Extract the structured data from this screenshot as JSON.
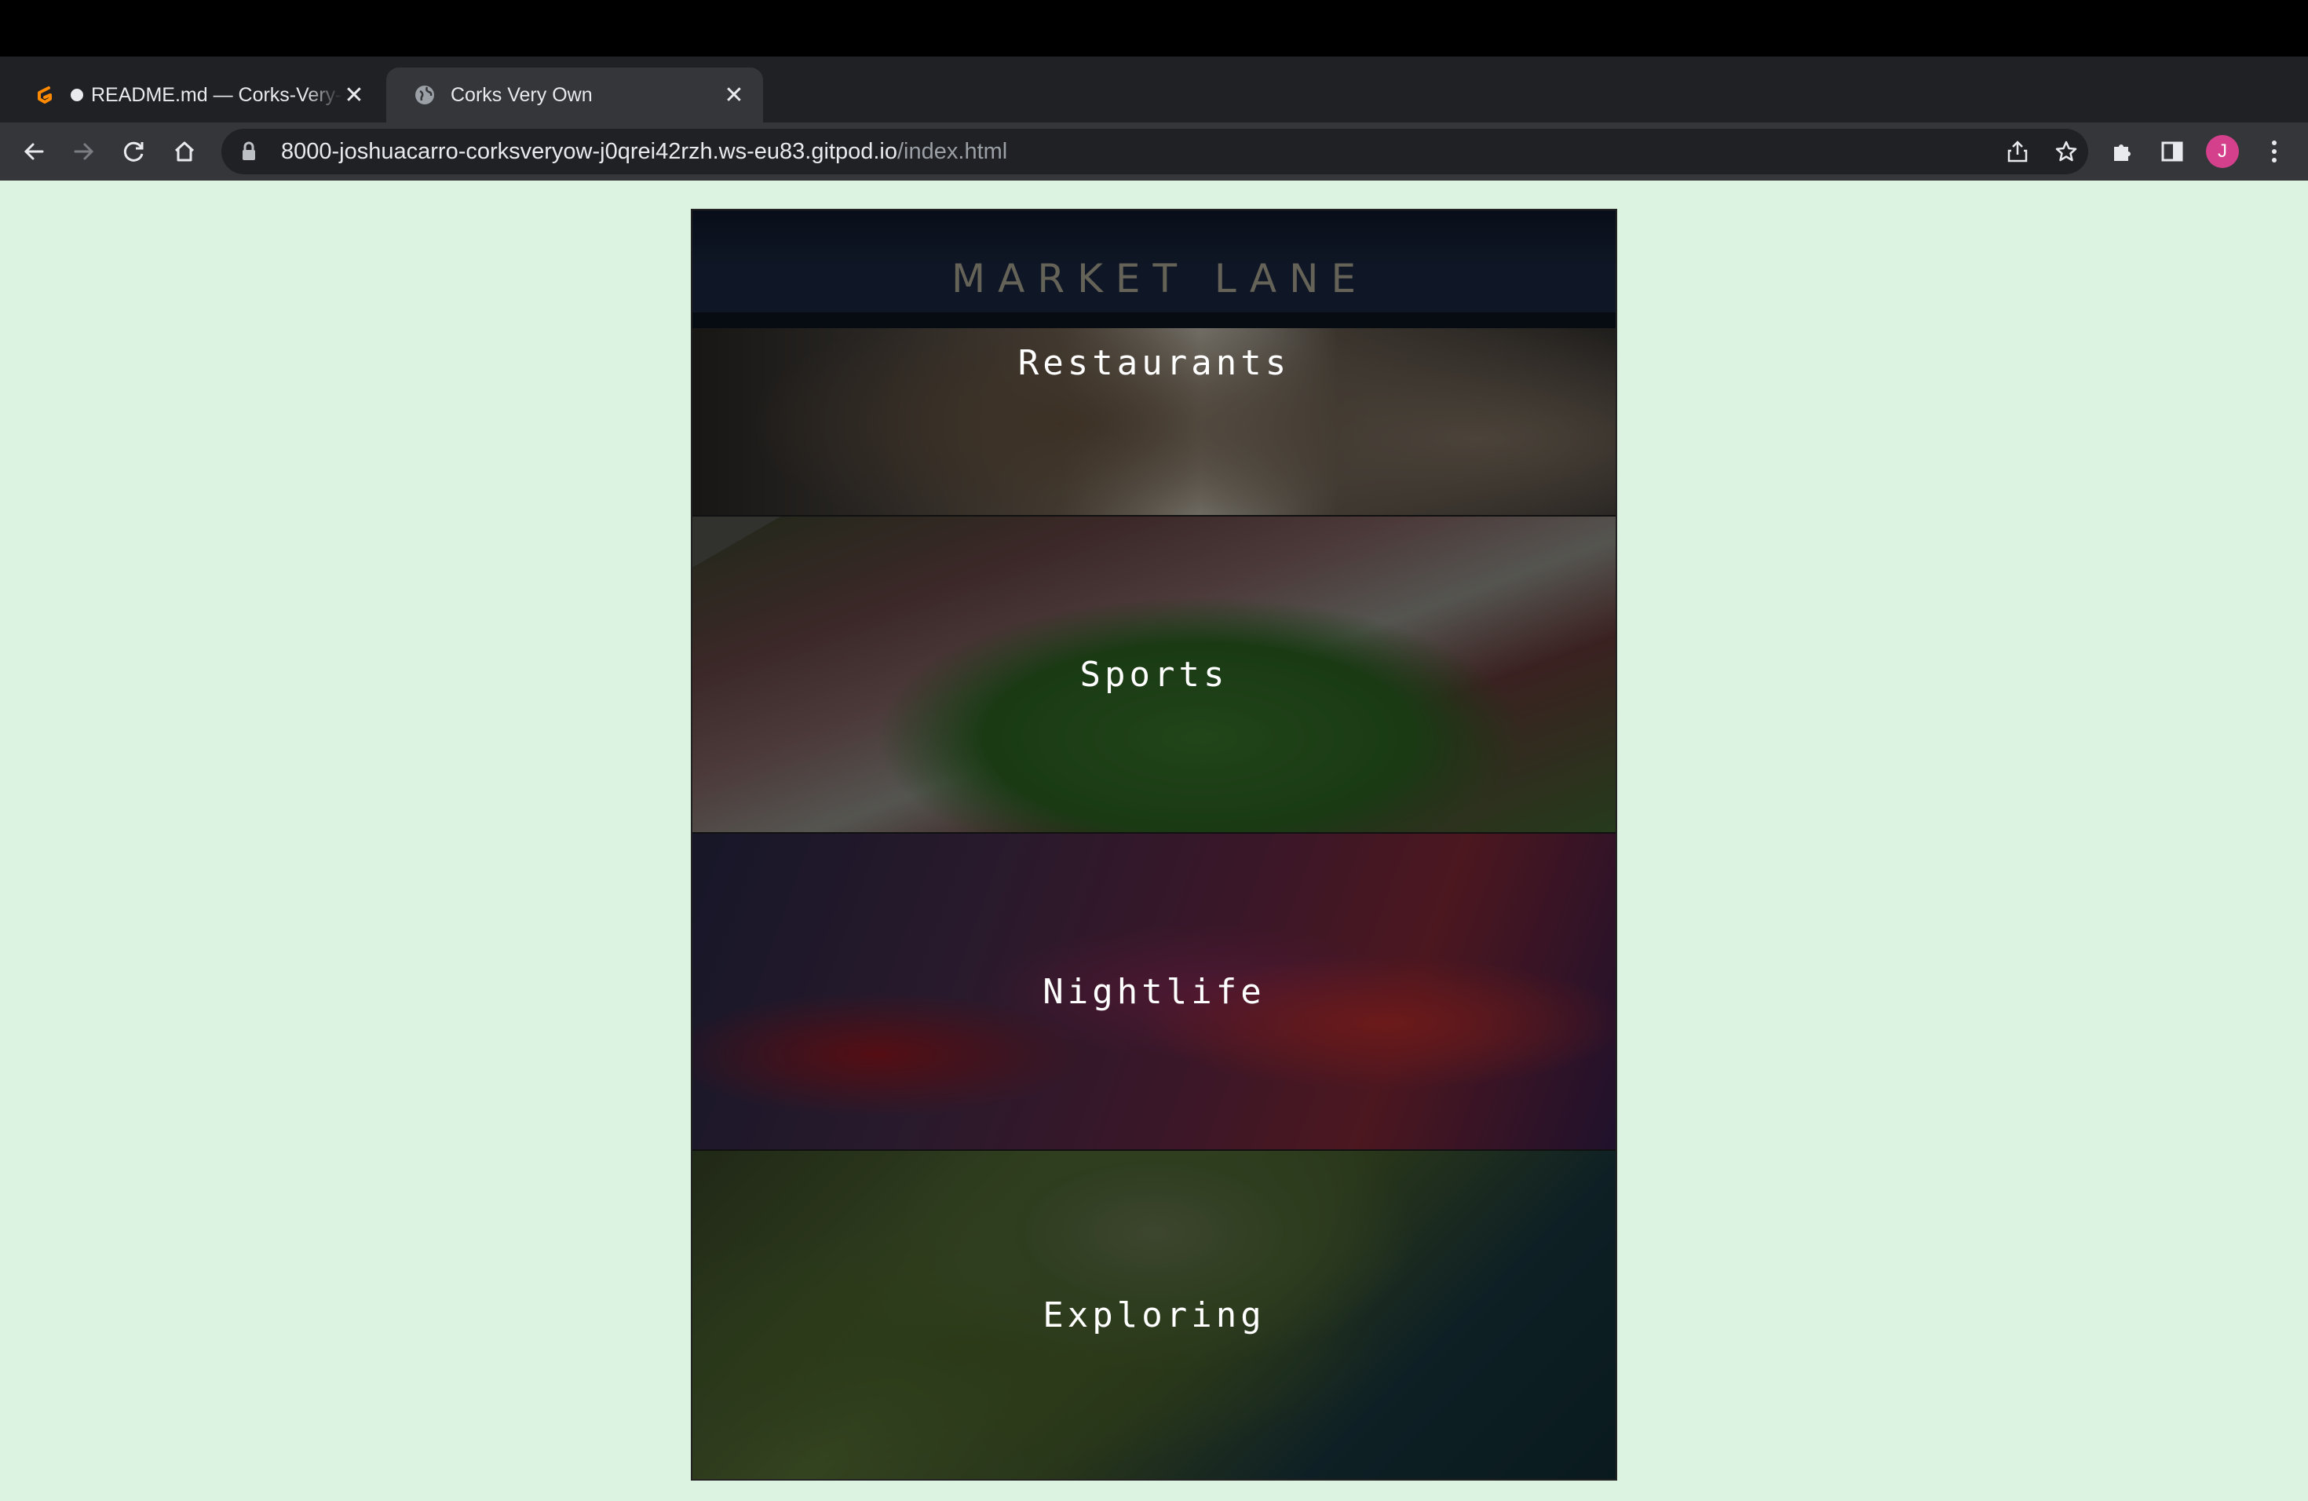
{
  "browser": {
    "tabs": [
      {
        "title": "README.md — Corks-Very-Own",
        "active": false,
        "unsaved_dot": true,
        "favicon": "gitpod-icon"
      },
      {
        "title": "Corks Very Own",
        "active": true,
        "favicon": "globe-icon"
      }
    ],
    "new_tab_label": "+",
    "url_host": "8000-joshuacarro-corksveryow-j0qrei42rzh.ws-eu83.gitpod.io",
    "url_path": "/index.html",
    "profile_initial": "J",
    "colors": {
      "tabstrip": "#202124",
      "toolbar": "#35363a",
      "avatar": "#d4408b"
    }
  },
  "page": {
    "background": "#dcf3e2",
    "cards": [
      {
        "label": "Restaurants",
        "sign": "MARKET LANE"
      },
      {
        "label": "Sports"
      },
      {
        "label": "Nightlife"
      },
      {
        "label": "Exploring"
      }
    ]
  }
}
